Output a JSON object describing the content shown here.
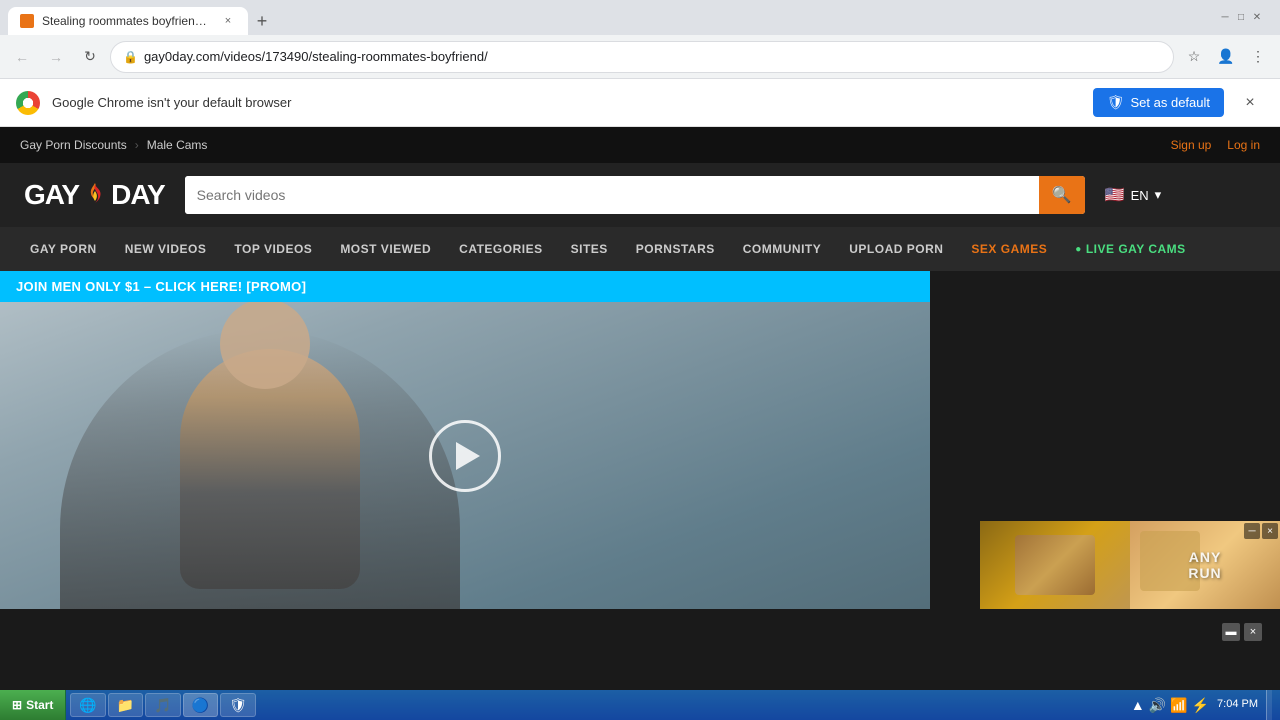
{
  "browser": {
    "tab_title": "Stealing roommates boyfriend at Ga...",
    "tab_favicon": "🔥",
    "url": "gay0day.com/videos/173490/stealing-roommates-boyfriend/",
    "new_tab_label": "+",
    "back_tooltip": "Back",
    "forward_tooltip": "Forward",
    "reload_tooltip": "Reload"
  },
  "notification": {
    "text": "Google Chrome isn't your default browser",
    "button_label": "Set as default",
    "close_label": "×"
  },
  "site": {
    "logo": "GAY0DAY",
    "logo_parts": {
      "gay": "GAY",
      "zero": "0",
      "day": "DAY"
    },
    "top_bar": {
      "left_links": [
        {
          "label": "Gay Porn Discounts"
        },
        {
          "label": "Male Cams"
        }
      ],
      "right_links": [
        {
          "label": "Sign up"
        },
        {
          "label": "Log in"
        }
      ]
    },
    "search": {
      "placeholder": "Search videos",
      "button_icon": "🔍"
    },
    "lang": {
      "flag": "🇺🇸",
      "code": "EN"
    },
    "nav": [
      {
        "label": "GAY PORN",
        "type": "normal"
      },
      {
        "label": "NEW VIDEOS",
        "type": "normal"
      },
      {
        "label": "TOP VIDEOS",
        "type": "normal"
      },
      {
        "label": "MOST VIEWED",
        "type": "normal"
      },
      {
        "label": "CATEGORIES",
        "type": "normal"
      },
      {
        "label": "SITES",
        "type": "normal"
      },
      {
        "label": "PORNSTARS",
        "type": "normal"
      },
      {
        "label": "COMMUNITY",
        "type": "normal"
      },
      {
        "label": "UPLOAD PORN",
        "type": "normal"
      },
      {
        "label": "SEX GAMES",
        "type": "sex-games"
      },
      {
        "label": "LIVE GAY CAMS",
        "type": "live-cams"
      }
    ],
    "promo": {
      "text": "JOIN MEN ONLY $1 – CLICK HERE! [PROMO]"
    },
    "ad_controls": {
      "minimize": "▬",
      "close": "×"
    }
  },
  "taskbar": {
    "start_label": "Start",
    "items": [],
    "icons": [
      "🔊",
      "📶",
      "⚡"
    ],
    "time": "7:04 PM",
    "apps": [
      "ie",
      "folder",
      "media",
      "chrome",
      "shield"
    ]
  }
}
